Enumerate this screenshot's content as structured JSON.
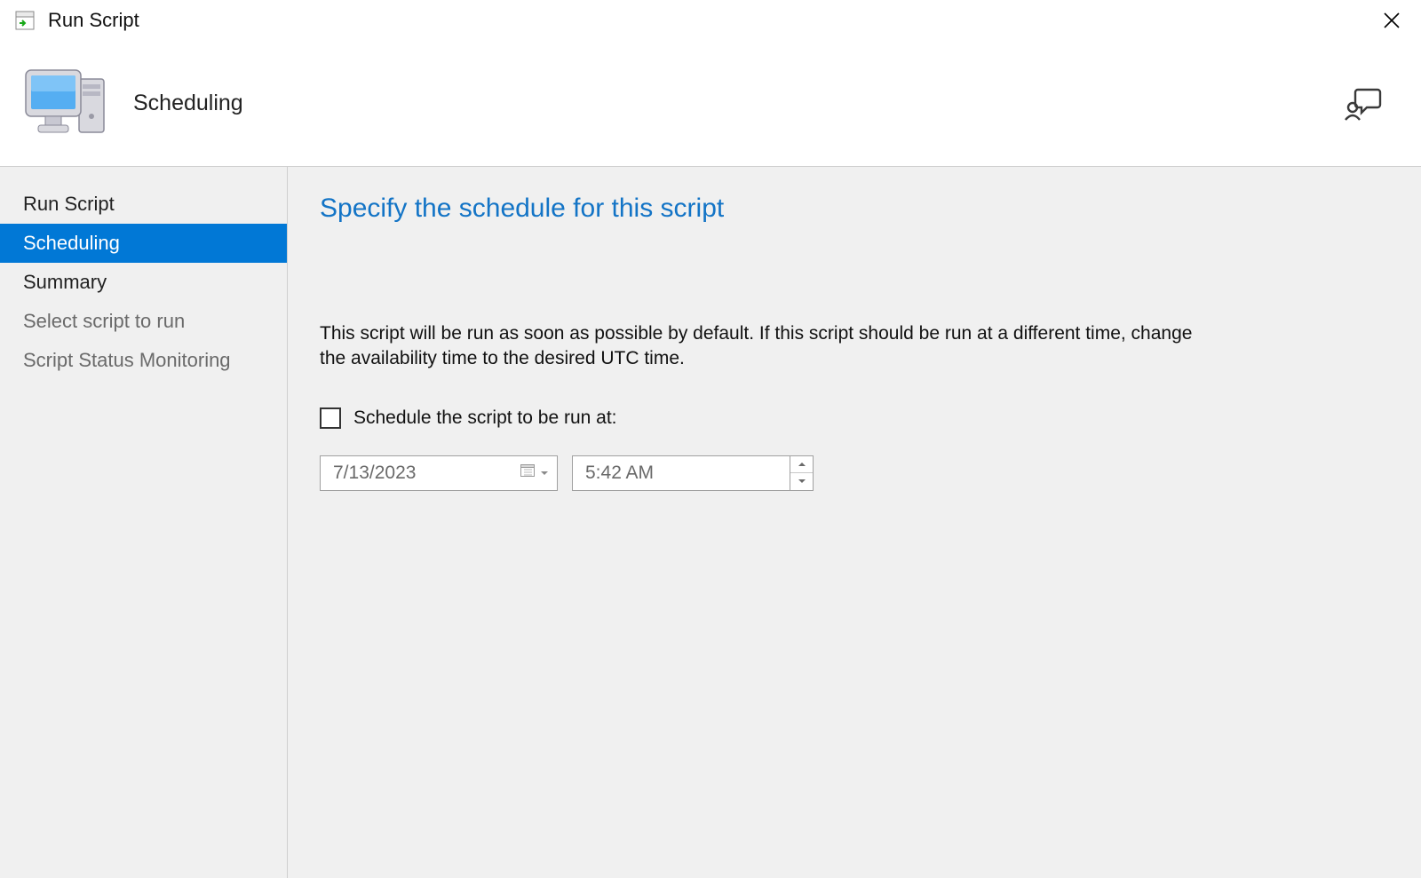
{
  "window": {
    "title": "Run Script"
  },
  "banner": {
    "title": "Scheduling"
  },
  "sidebar": {
    "items": [
      {
        "label": "Run Script",
        "active": false,
        "muted": false
      },
      {
        "label": "Scheduling",
        "active": true,
        "muted": false
      },
      {
        "label": "Summary",
        "active": false,
        "muted": false
      },
      {
        "label": "Select script to run",
        "active": false,
        "muted": true
      },
      {
        "label": "Script Status Monitoring",
        "active": false,
        "muted": true
      }
    ]
  },
  "content": {
    "section_title": "Specify the schedule for this script",
    "description": "This script will be run as soon as possible by default. If this script should be run at a different time, change the availability time to the desired UTC time.",
    "checkbox_label": "Schedule the script to be run at:",
    "checkbox_checked": false,
    "date_value": "7/13/2023",
    "time_value": "5:42 AM"
  }
}
